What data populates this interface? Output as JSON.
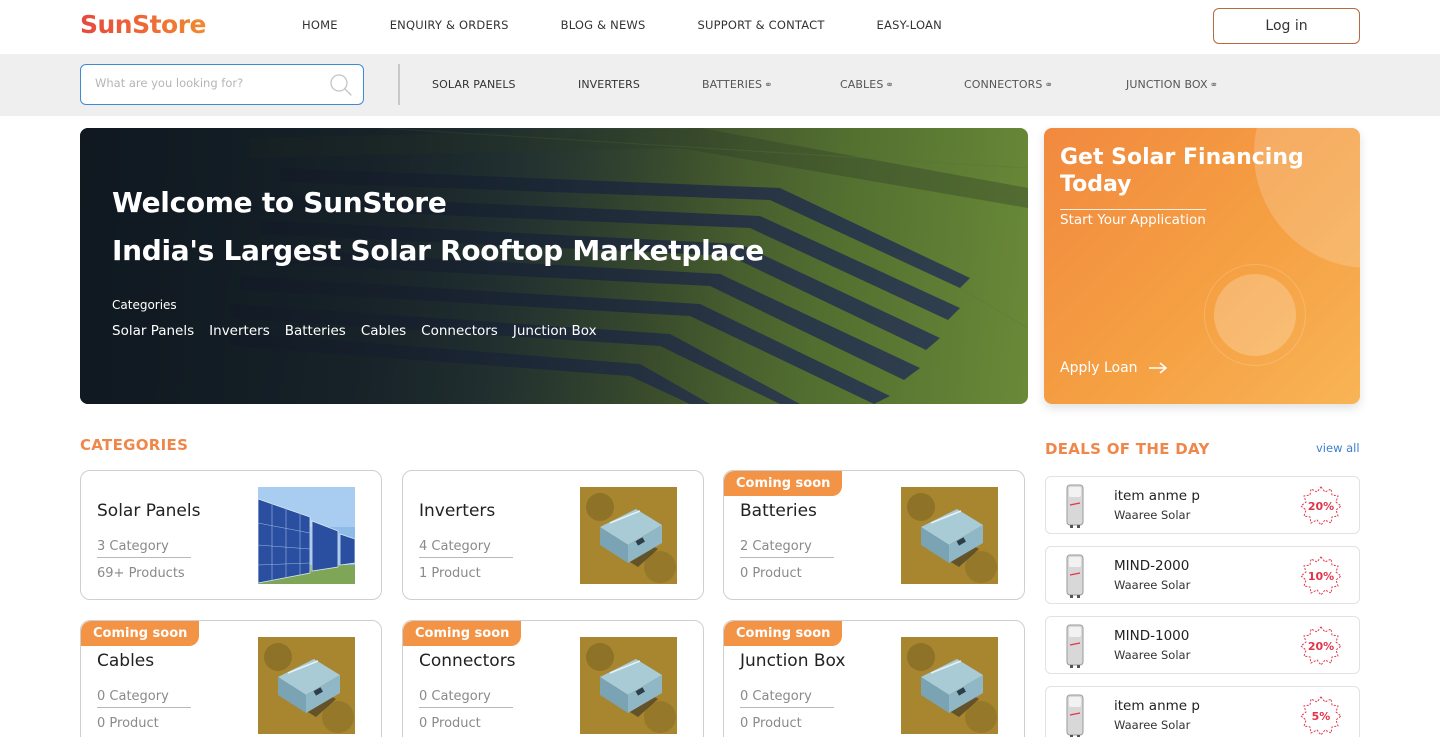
{
  "brand": {
    "logo": "SunStore"
  },
  "header": {
    "nav": [
      "HOME",
      "ENQUIRY & ORDERS",
      "BLOG & NEWS",
      "SUPPORT & CONTACT",
      "EASY-LOAN"
    ],
    "login_label": "Log in"
  },
  "search": {
    "placeholder": "What are you looking for?",
    "value": ""
  },
  "category_nav": [
    {
      "label": "SOLAR PANELS",
      "external": false
    },
    {
      "label": "INVERTERS",
      "external": false
    },
    {
      "label": "BATTERIES",
      "external": true
    },
    {
      "label": "CABLES",
      "external": true
    },
    {
      "label": "CONNECTORS",
      "external": true
    },
    {
      "label": "JUNCTION BOX",
      "external": true
    }
  ],
  "hero": {
    "line1": "Welcome to SunStore",
    "line2": "India's Largest Solar Rooftop Marketplace",
    "categories_label": "Categories",
    "categories": [
      "Solar Panels",
      "Inverters",
      "Batteries",
      "Cables",
      "Connectors",
      "Junction Box"
    ]
  },
  "finance": {
    "title": "Get Solar Financing Today",
    "subtitle": "Start Your Application",
    "cta": "Apply Loan"
  },
  "categories_section": {
    "title": "CATEGORIES",
    "cards": [
      {
        "name": "Solar Panels",
        "categories": "3 Category",
        "products": "69+ Products",
        "badge": "",
        "image": "solar-panels"
      },
      {
        "name": "Inverters",
        "categories": "4 Category",
        "products": "1 Product",
        "badge": "",
        "image": "battery-box"
      },
      {
        "name": "Batteries",
        "categories": "2 Category",
        "products": "0 Product",
        "badge": "Coming soon",
        "image": "battery-box"
      },
      {
        "name": "Cables",
        "categories": "0 Category",
        "products": "0 Product",
        "badge": "Coming soon",
        "image": "battery-box"
      },
      {
        "name": "Connectors",
        "categories": "0 Category",
        "products": "0 Product",
        "badge": "Coming soon",
        "image": "battery-box"
      },
      {
        "name": "Junction Box",
        "categories": "0 Category",
        "products": "0 Product",
        "badge": "Coming soon",
        "image": "battery-box"
      }
    ]
  },
  "deals": {
    "title": "DEALS OF THE DAY",
    "view_all": "view all",
    "items": [
      {
        "name": "item anme p",
        "brand": "Waaree Solar",
        "discount": "20%"
      },
      {
        "name": "MIND-2000",
        "brand": "Waaree Solar",
        "discount": "10%"
      },
      {
        "name": "MIND-1000",
        "brand": "Waaree Solar",
        "discount": "20%"
      },
      {
        "name": "item anme p",
        "brand": "Waaree Solar",
        "discount": "5%"
      }
    ]
  },
  "colors": {
    "accent": "#f0874a",
    "badge": "#f39345",
    "search_border": "#3d8bd4",
    "discount": "#e1344a",
    "link": "#3b7fcf"
  }
}
